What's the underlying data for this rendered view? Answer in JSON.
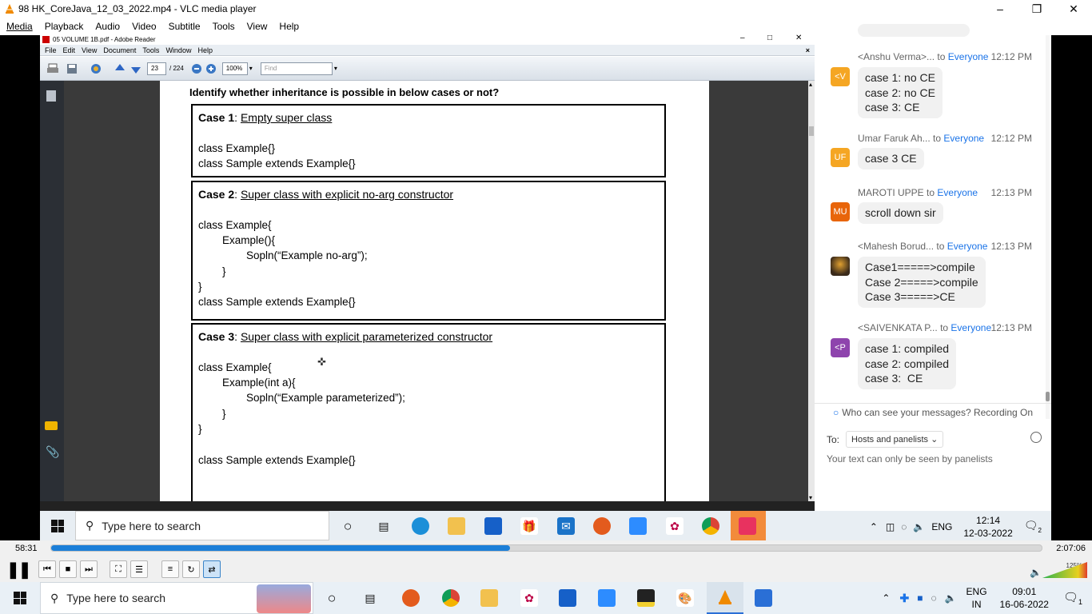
{
  "window": {
    "title": "98 HK_CoreJava_12_03_2022.mp4 - VLC media player"
  },
  "menu": [
    "Media",
    "Playback",
    "Audio",
    "Video",
    "Subtitle",
    "Tools",
    "View",
    "Help"
  ],
  "reader": {
    "title": "05 VOLUME 1B.pdf - Adobe Reader",
    "menu": [
      "File",
      "Edit",
      "View",
      "Document",
      "Tools",
      "Window",
      "Help"
    ],
    "page_current": "23",
    "page_total": "/ 224",
    "zoom": "100%",
    "find_placeholder": "Find"
  },
  "document": {
    "heading": "Identify whether inheritance is possible in below cases or not?",
    "cases": [
      {
        "num": "Case 1",
        "sep": ": ",
        "title": "Empty super class",
        "lines": [
          "class Example{}",
          "class Sample extends Example{}"
        ]
      },
      {
        "num": "Case 2",
        "sep": ": ",
        "title": "Super class with explicit no-arg constructor",
        "lines": [
          "class Example{",
          "        Example(){",
          "                Sopln(“Example no-arg”);",
          "        }",
          "}",
          "class Sample extends Example{}"
        ]
      },
      {
        "num": "Case 3",
        "sep": ": ",
        "title": "Super class with explicit parameterized constructor",
        "lines": [
          "class Example{",
          "        Example(int a){",
          "                Sopln(“Example parameterized”);",
          "        }",
          "}",
          "",
          "class Sample extends Example{}"
        ]
      }
    ]
  },
  "chat": {
    "messages": [
      {
        "sender": "<Anshu Verma>...",
        "to": "to",
        "audience": "Everyone",
        "time": "12:12 PM",
        "initials": "<V",
        "color": "#f5a623",
        "text": "case 1: no CE\ncase 2: no CE\ncase 3: CE"
      },
      {
        "sender": "Umar Faruk Ah...",
        "to": "to",
        "audience": "Everyone",
        "time": "12:12 PM",
        "initials": "UF",
        "color": "#f5a623",
        "text": "case 3 CE"
      },
      {
        "sender": "MAROTI UPPE",
        "to": "to",
        "audience": "Everyone",
        "time": "12:13 PM",
        "initials": "MU",
        "color": "#e8650a",
        "text": "scroll down sir"
      },
      {
        "sender": "<Mahesh Borud...",
        "to": "to",
        "audience": "Everyone",
        "time": "12:13 PM",
        "initials": "",
        "color": "#3a2a1a",
        "text": "Case1=====>compile\nCase 2=====>compile\nCase 3=====>CE"
      },
      {
        "sender": "<SAIVENKATA P...",
        "to": "to",
        "audience": "Everyone",
        "time": "12:13 PM",
        "initials": "<P",
        "color": "#8e44ad",
        "text": "case 1: compiled\ncase 2: compiled\ncase 3:  CE"
      }
    ],
    "visibility_note": "Who can see your messages? Recording On",
    "to_label": "To:",
    "to_value": "Hosts and panelists",
    "input_placeholder": "Your text can only be seen by panelists"
  },
  "inner_taskbar": {
    "search": "Type here to search",
    "lang": "ENG",
    "time": "12:14",
    "date": "12-03-2022",
    "notif": "2"
  },
  "player": {
    "elapsed": "58:31",
    "total": "2:07:06",
    "progress": 0.463,
    "volume": "125%"
  },
  "taskbar": {
    "search": "Type here to search",
    "lang": "ENG",
    "lang2": "IN",
    "time": "09:01",
    "date": "16-06-2022",
    "notif": "1"
  }
}
